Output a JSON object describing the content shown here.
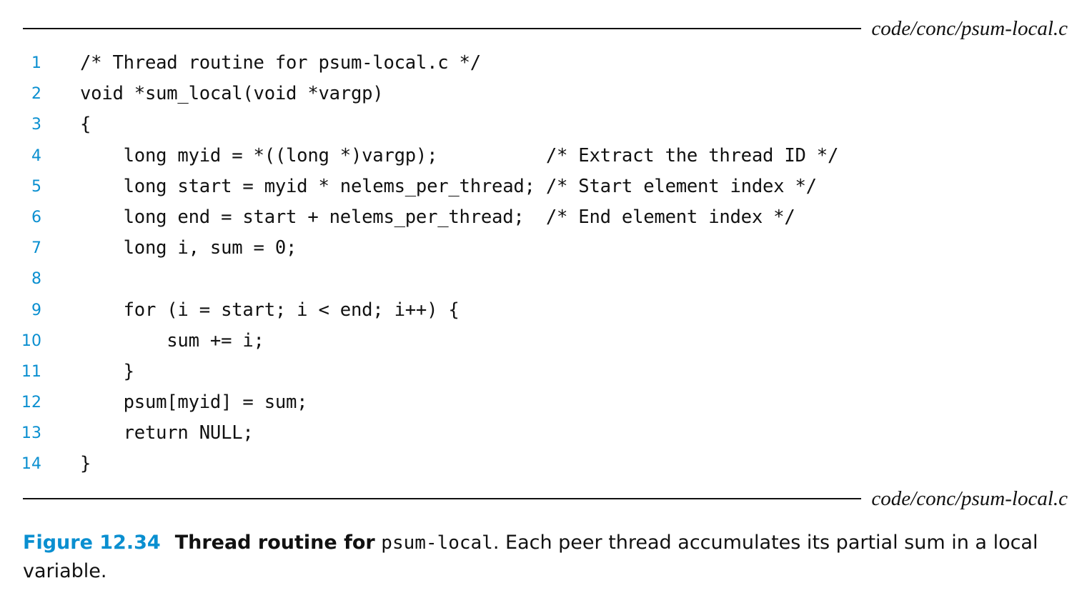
{
  "header": {
    "file_label": "code/conc/psum-local.c"
  },
  "footer": {
    "file_label": "code/conc/psum-local.c"
  },
  "code_lines": [
    {
      "num": "1",
      "code": "/* Thread routine for psum-local.c */"
    },
    {
      "num": "2",
      "code": "void *sum_local(void *vargp)"
    },
    {
      "num": "3",
      "code": "{"
    },
    {
      "num": "4",
      "code": "    long myid = *((long *)vargp);          /* Extract the thread ID */"
    },
    {
      "num": "5",
      "code": "    long start = myid * nelems_per_thread; /* Start element index */"
    },
    {
      "num": "6",
      "code": "    long end = start + nelems_per_thread;  /* End element index */"
    },
    {
      "num": "7",
      "code": "    long i, sum = 0;"
    },
    {
      "num": "8",
      "code": ""
    },
    {
      "num": "9",
      "code": "    for (i = start; i < end; i++) {"
    },
    {
      "num": "10",
      "code": "        sum += i;"
    },
    {
      "num": "11",
      "code": "    }"
    },
    {
      "num": "12",
      "code": "    psum[myid] = sum;"
    },
    {
      "num": "13",
      "code": "    return NULL;"
    },
    {
      "num": "14",
      "code": "}"
    }
  ],
  "caption": {
    "figure_number": "Figure 12.34",
    "title": "Thread routine for",
    "title_code": "psum-local",
    "text": ". Each peer thread accumulates its partial sum in a local variable."
  },
  "colors": {
    "accent": "#0a8fd0",
    "text": "#111111"
  }
}
